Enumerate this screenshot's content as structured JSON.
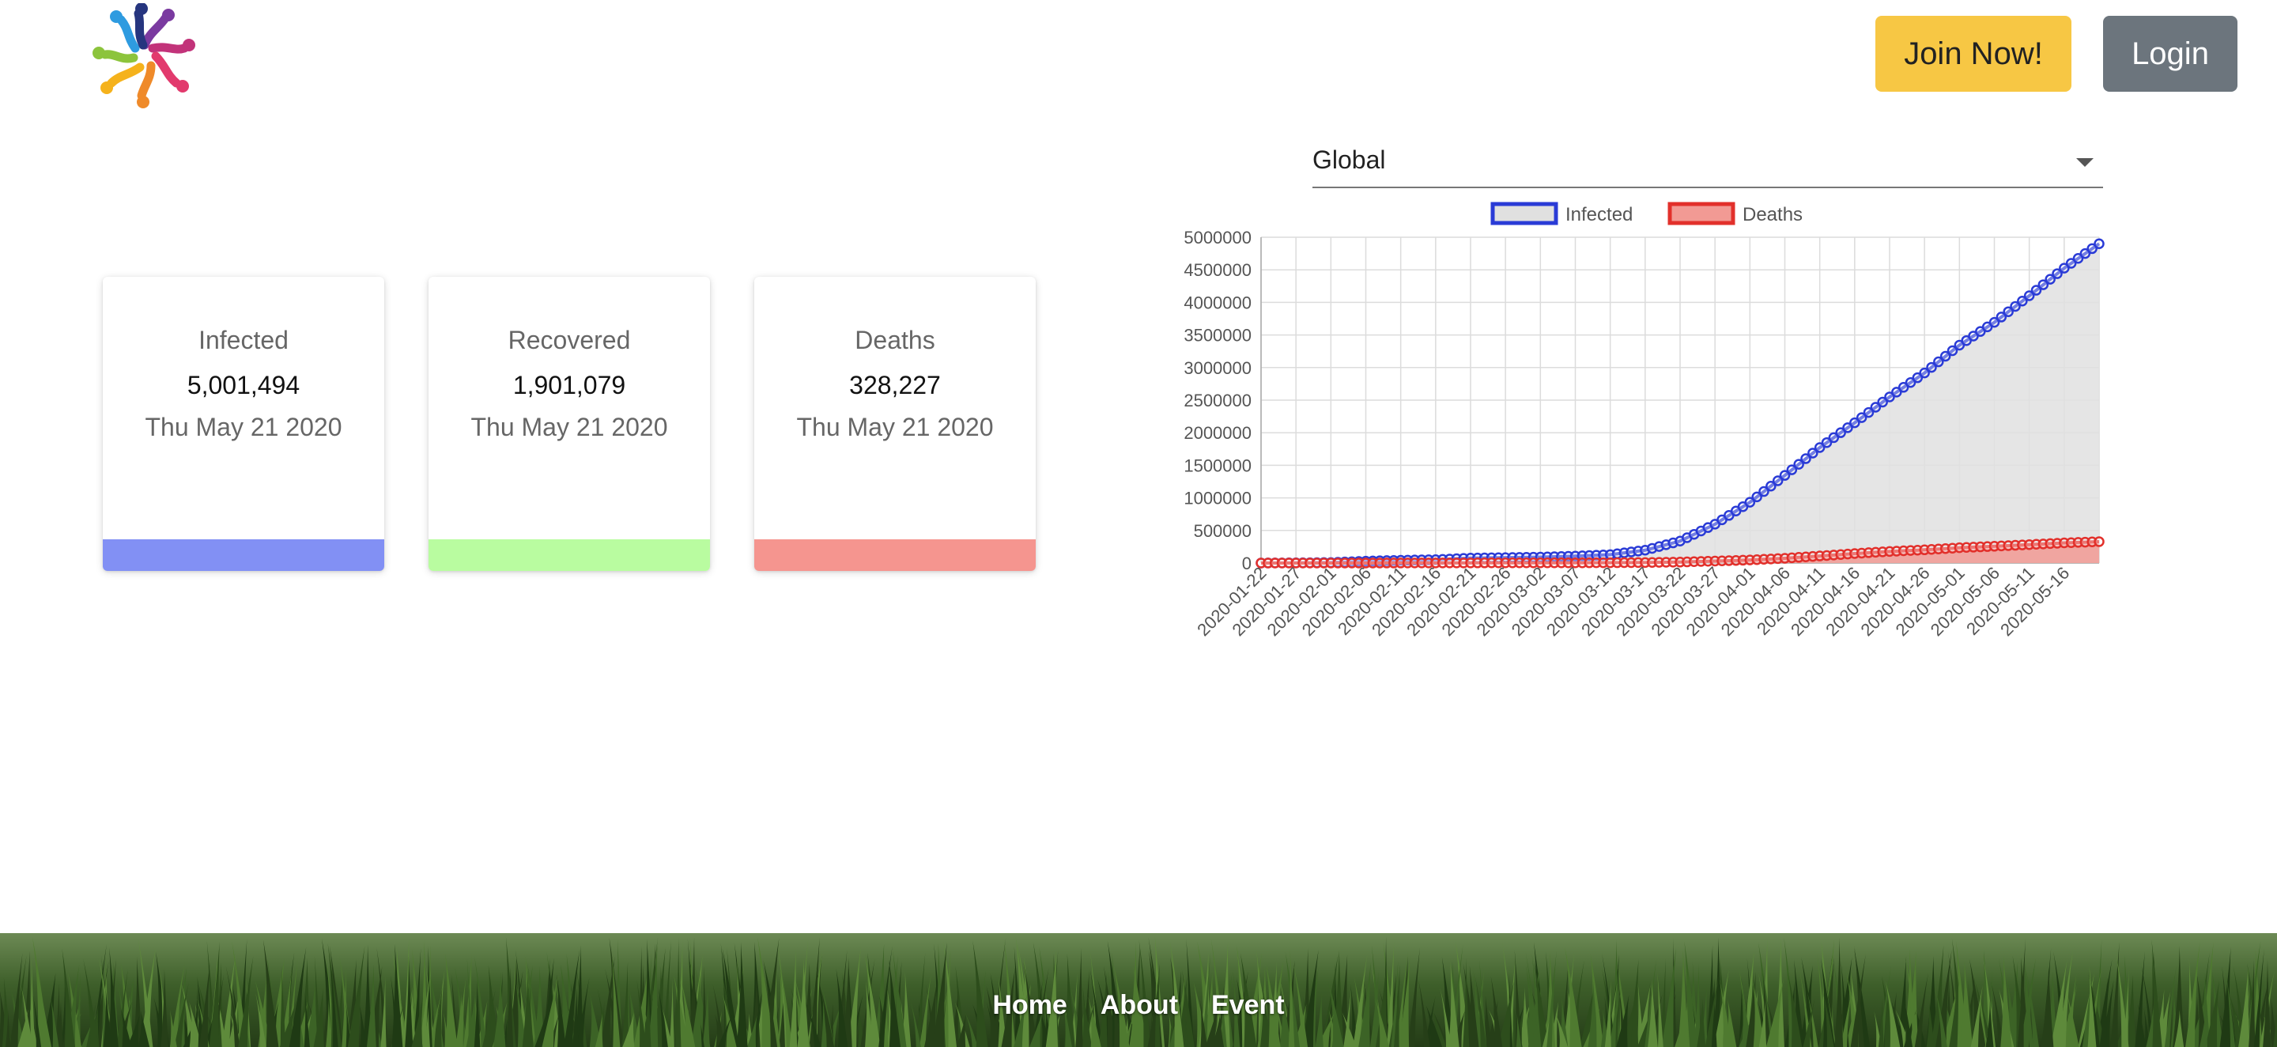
{
  "header": {
    "logo_icon": "people-circle-logo",
    "join_label": "Join Now!",
    "login_label": "Login",
    "join_color": "#f7c744",
    "login_color": "#6c757d"
  },
  "stats": [
    {
      "label": "Infected",
      "value": "5,001,494",
      "date": "Thu May 21 2020",
      "color": "#8290f4"
    },
    {
      "label": "Recovered",
      "value": "1,901,079",
      "date": "Thu May 21 2020",
      "color": "#b9fca0"
    },
    {
      "label": "Deaths",
      "value": "328,227",
      "date": "Thu May 21 2020",
      "color": "#f5958f"
    }
  ],
  "region_select": {
    "selected": "Global"
  },
  "footer": {
    "links": [
      "Home",
      "About",
      "Event"
    ]
  },
  "chart_data": {
    "type": "line",
    "title": "",
    "xlabel": "",
    "ylabel": "",
    "legend_position": "top",
    "ylim": [
      0,
      5000000
    ],
    "y_ticks": [
      "5000000",
      "4500000",
      "4000000",
      "3500000",
      "3000000",
      "2500000",
      "2000000",
      "1500000",
      "1000000",
      "500000",
      "0"
    ],
    "x_tick_labels": [
      "2020-01-22",
      "2020-01-27",
      "2020-02-01",
      "2020-02-06",
      "2020-02-11",
      "2020-02-16",
      "2020-02-21",
      "2020-02-26",
      "2020-03-02",
      "2020-03-07",
      "2020-03-12",
      "2020-03-17",
      "2020-03-22",
      "2020-03-27",
      "2020-04-01",
      "2020-04-06",
      "2020-04-11",
      "2020-04-16",
      "2020-04-21",
      "2020-04-26",
      "2020-05-01",
      "2020-05-06",
      "2020-05-11",
      "2020-05-16"
    ],
    "grid": true,
    "series": [
      {
        "name": "Infected",
        "color": "#2a3bd6",
        "fill": "#e0e0e0",
        "values": [
          555,
          2927,
          7818,
          28276,
          43103,
          51174,
          76197,
          82756,
          90306,
          105836,
          128343,
          197102,
          336953,
          595800,
          932605,
          1345048,
          1772307,
          2152437,
          2549123,
          2917562,
          3343777,
          3693625,
          4101699,
          4525116,
          4900000
        ]
      },
      {
        "name": "Deaths",
        "color": "#e2302b",
        "fill": "#f29a94",
        "values": [
          17,
          82,
          259,
          564,
          1018,
          1666,
          2247,
          2810,
          3085,
          3558,
          4720,
          7905,
          14608,
          30102,
          46809,
          73139,
          108503,
          146088,
          177641,
          202668,
          234704,
          257239,
          282709,
          309101,
          328227
        ]
      }
    ]
  }
}
